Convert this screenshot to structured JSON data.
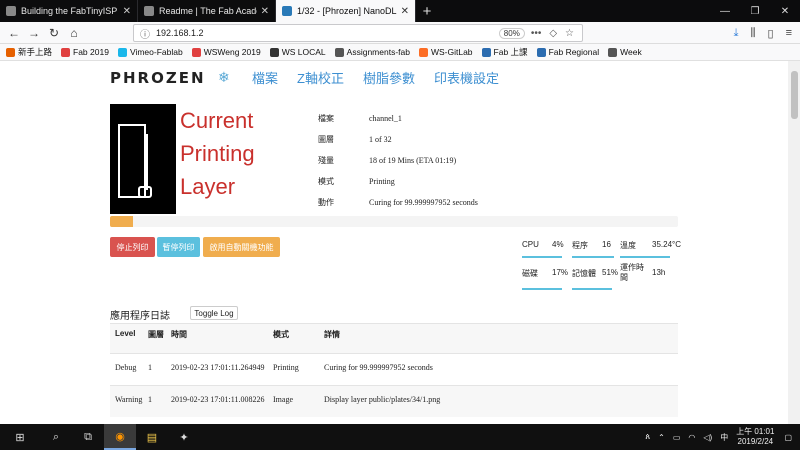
{
  "browser": {
    "tabs": [
      {
        "title": "Building the FabTinyISP",
        "active": false
      },
      {
        "title": "Readme | The Fab Academy F",
        "active": false
      },
      {
        "title": "1/32 - [Phrozen] NanoDLP",
        "active": true
      }
    ],
    "url": "192.168.1.2",
    "zoom": "80%",
    "bookmarks": [
      "新手上路",
      "Fab 2019",
      "Vimeo-Fablab",
      "WSWeng 2019",
      "WS LOCAL",
      "Assignments-fab",
      "WS-GitLab",
      "Fab 上課",
      "Fab Regional",
      "Week"
    ]
  },
  "header": {
    "brand": "PHROZEN",
    "nav": [
      "檔案",
      "Z軸校正",
      "樹脂參數",
      "印表機設定"
    ]
  },
  "status": {
    "title_lines": [
      "Current",
      "Printing",
      "Layer"
    ],
    "fields": [
      {
        "label": "檔案",
        "value": "channel_1"
      },
      {
        "label": "圖層",
        "value": "1 of 32"
      },
      {
        "label": "殘量",
        "value": "18 of 19 Mins (ETA 01:19)"
      },
      {
        "label": "模式",
        "value": "Printing"
      },
      {
        "label": "動作",
        "value": "Curing for 99.999997952 seconds"
      }
    ],
    "progress_fraction": 0.04
  },
  "controls": {
    "stop": "停止列印",
    "pause": "暫停列印",
    "auto_shutdown": "啟用自動關機功能"
  },
  "stats": {
    "cpu_label": "CPU",
    "cpu": "4%",
    "proc_label": "程序",
    "proc": "16",
    "temp_label": "溫度",
    "temp": "35.24°C",
    "disk_label": "磁碟",
    "disk": "17%",
    "mem_label": "記憶體",
    "mem": "51%",
    "uptime_label": "運作時間",
    "uptime": "13h"
  },
  "log": {
    "title": "應用程序日誌",
    "toggle": "Toggle Log",
    "headers": {
      "level": "Level",
      "layer": "圖層",
      "time": "時間",
      "mode": "模式",
      "detail": "詳情"
    },
    "rows": [
      {
        "level": "Debug",
        "layer": "1",
        "time": "2019-02-23 17:01:11.264949",
        "mode": "Printing",
        "detail": "Curing for 99.999997952 seconds"
      },
      {
        "level": "Warning",
        "layer": "1",
        "time": "2019-02-23 17:01:11.008226",
        "mode": "Image",
        "detail": "Display layer public/plates/34/1.png"
      }
    ]
  },
  "taskbar": {
    "time": "上午 01:01",
    "date": "2019/2/24"
  }
}
